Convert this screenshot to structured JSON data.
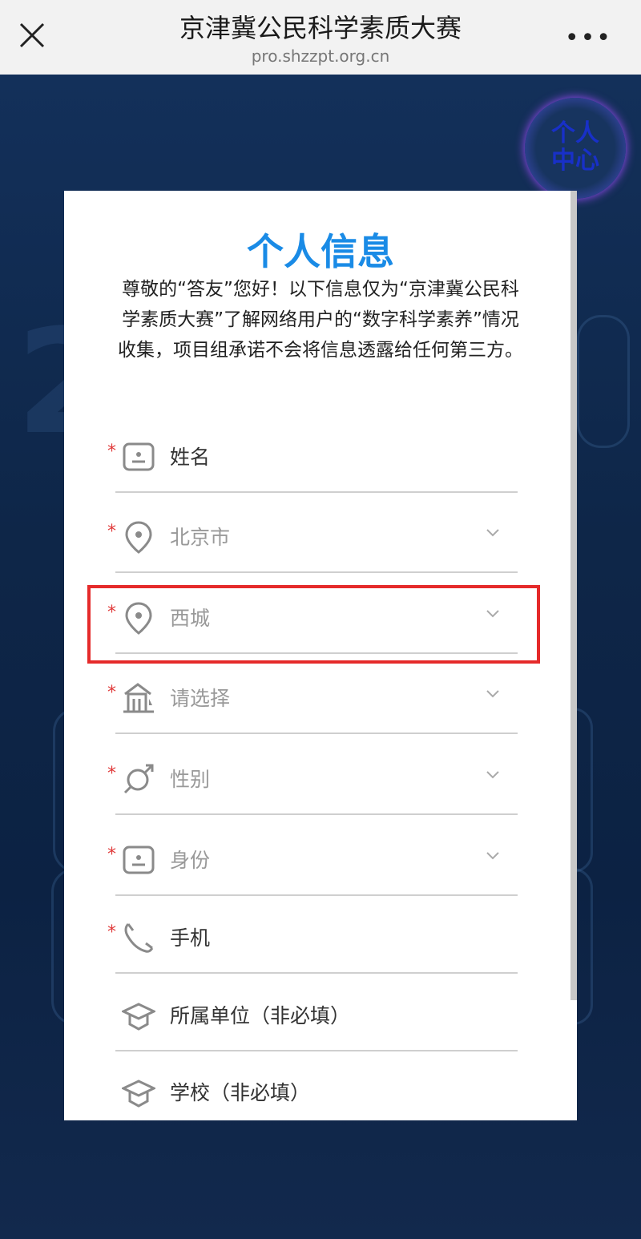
{
  "topbar": {
    "title": "京津冀公民科学素质大赛",
    "url": "pro.shzzpt.org.cn",
    "more": "•••"
  },
  "floating": {
    "line1": "个人",
    "line2": "中心"
  },
  "card": {
    "title": "个人信息",
    "intro": "尊敬的“答友”您好！以下信息仅为“京津冀公民科学素质大赛”了解网络用户的“数字科学素养”情况收集，项目组承诺不会将信息透露给任何第三方。"
  },
  "form": {
    "fields": [
      {
        "label": "姓名",
        "required": true,
        "icon": "id-card-icon",
        "dropdown": false
      },
      {
        "label": "北京市",
        "required": true,
        "icon": "location-pin-icon",
        "dropdown": true
      },
      {
        "label": "西城",
        "required": true,
        "icon": "location-pin-icon",
        "dropdown": true
      },
      {
        "label": "请选择",
        "required": true,
        "icon": "building-icon",
        "dropdown": true
      },
      {
        "label": "性别",
        "required": true,
        "icon": "gender-icon",
        "dropdown": true
      },
      {
        "label": "身份",
        "required": true,
        "icon": "id-card-icon",
        "dropdown": true
      },
      {
        "label": "手机",
        "required": true,
        "icon": "phone-icon",
        "dropdown": false
      },
      {
        "label": "所属单位（非必填）",
        "required": false,
        "icon": "graduation-cap-icon",
        "dropdown": false
      },
      {
        "label": "学校（非必填）",
        "required": false,
        "icon": "graduation-cap-icon",
        "dropdown": false
      }
    ],
    "required_mark": "*"
  },
  "colors": {
    "accent": "#1a8be6",
    "required": "#e03a3a",
    "highlight": "#e52a2a"
  }
}
